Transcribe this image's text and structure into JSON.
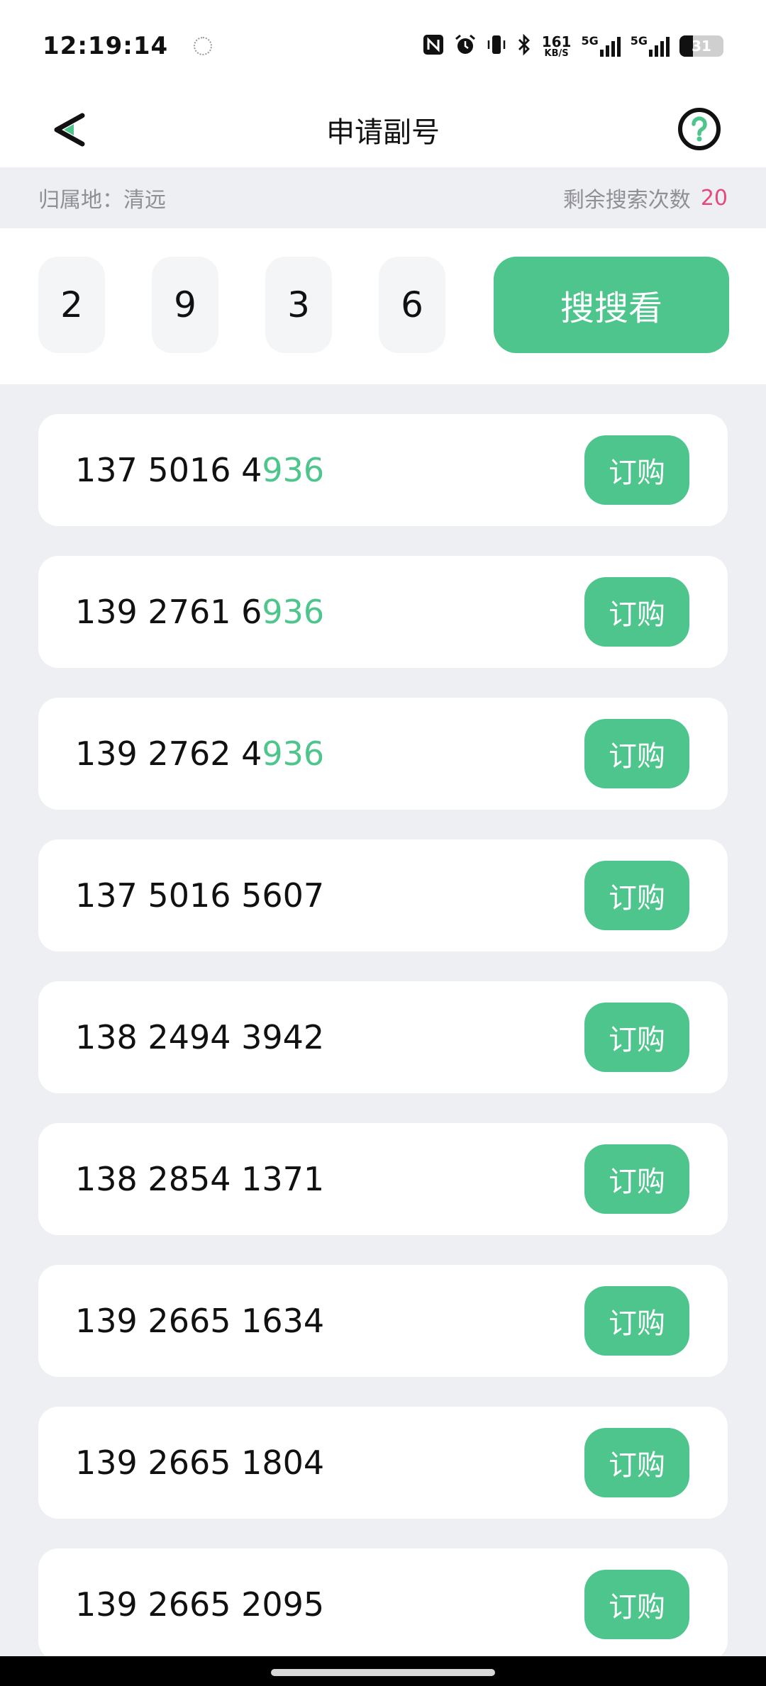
{
  "status_bar": {
    "time": "12:19:14",
    "speed_top": "161",
    "speed_unit": "KB/S",
    "net1": "5G",
    "net2": "5G",
    "battery": "31",
    "battery_fraction": 0.31,
    "icons": [
      "nfc-icon",
      "alarm-icon",
      "vibrate-icon",
      "bluetooth-icon",
      "signal-icon",
      "battery-icon"
    ]
  },
  "header": {
    "title": "申请副号"
  },
  "info": {
    "location_label": "归属地：清远",
    "remaining_label": "剩余搜索次数",
    "remaining_count": "20"
  },
  "search": {
    "digits": [
      "2",
      "9",
      "3",
      "6"
    ],
    "button_label": "搜搜看"
  },
  "colors": {
    "accent": "#4ec58d",
    "count": "#e5487a",
    "background": "#eeeff3"
  },
  "numbers": [
    {
      "prefix": "137 5016 4",
      "highlight": "936",
      "action": "订购"
    },
    {
      "prefix": "139 2761 6",
      "highlight": "936",
      "action": "订购"
    },
    {
      "prefix": "139 2762 4",
      "highlight": "936",
      "action": "订购"
    },
    {
      "prefix": "137 5016 5607",
      "highlight": "",
      "action": "订购"
    },
    {
      "prefix": "138 2494 3942",
      "highlight": "",
      "action": "订购"
    },
    {
      "prefix": "138 2854 1371",
      "highlight": "",
      "action": "订购"
    },
    {
      "prefix": "139 2665 1634",
      "highlight": "",
      "action": "订购"
    },
    {
      "prefix": "139 2665 1804",
      "highlight": "",
      "action": "订购"
    },
    {
      "prefix": "139 2665 2095",
      "highlight": "",
      "action": "订购"
    }
  ]
}
